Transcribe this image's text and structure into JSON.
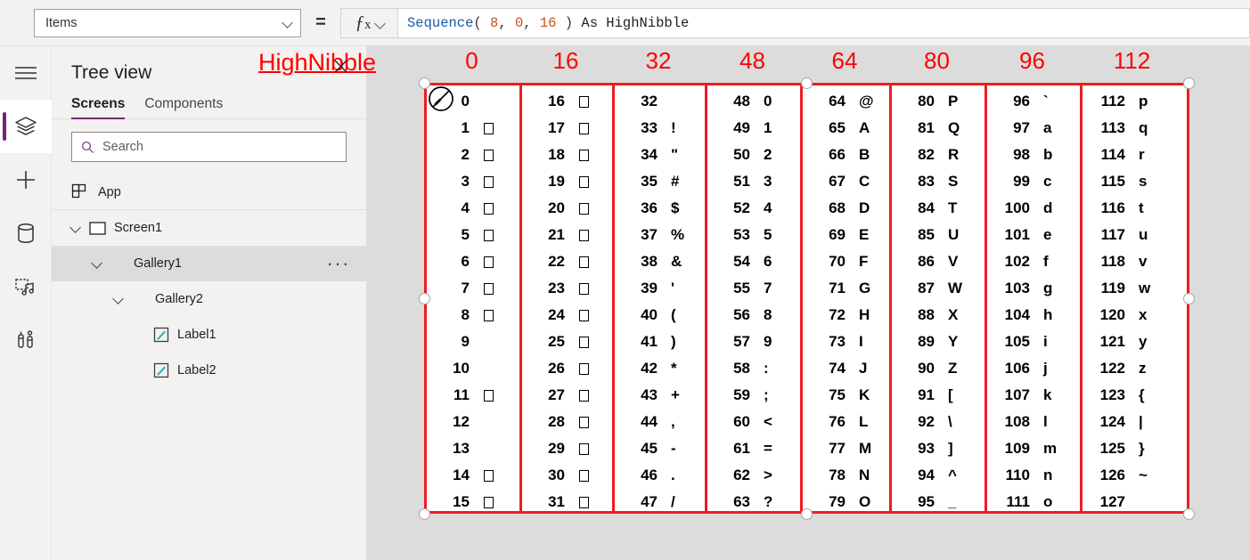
{
  "topbar": {
    "property_value": "Items",
    "equals": "=",
    "fx_label": "fx",
    "formula_parts": [
      {
        "text": "Sequence",
        "kind": "fn"
      },
      {
        "text": "( ",
        "kind": "pun"
      },
      {
        "text": "8",
        "kind": "num"
      },
      {
        "text": ", ",
        "kind": "pun"
      },
      {
        "text": "0",
        "kind": "num"
      },
      {
        "text": ", ",
        "kind": "pun"
      },
      {
        "text": "16",
        "kind": "num"
      },
      {
        "text": " ) ",
        "kind": "pun"
      },
      {
        "text": "As HighNibble",
        "kind": "id"
      }
    ],
    "formula_text": "Sequence( 8, 0, 16 ) As HighNibble"
  },
  "rail": {
    "items": [
      {
        "icon": "hamburger-menu-icon",
        "active": false
      },
      {
        "icon": "layers-tree-view-icon",
        "active": true
      },
      {
        "icon": "plus-insert-icon",
        "active": false
      },
      {
        "icon": "database-data-icon",
        "active": false
      },
      {
        "icon": "media-icon",
        "active": false
      },
      {
        "icon": "tools-settings-icon",
        "active": false
      }
    ]
  },
  "tree": {
    "title": "Tree view",
    "tabs": [
      {
        "label": "Screens",
        "selected": true
      },
      {
        "label": "Components",
        "selected": false
      }
    ],
    "search": {
      "placeholder": "Search",
      "value": "",
      "icon": "search-icon"
    },
    "app_row": {
      "label": "App",
      "icon": "app-icon"
    },
    "nodes": [
      {
        "label": "Screen1",
        "indent": 0,
        "icon": "screen-icon",
        "caret": true,
        "selected": false,
        "menu": false
      },
      {
        "label": "Gallery1",
        "indent": 1,
        "icon": "gallery-icon",
        "caret": true,
        "selected": true,
        "menu": true
      },
      {
        "label": "Gallery2",
        "indent": 2,
        "icon": "gallery-icon",
        "caret": true,
        "selected": false,
        "menu": false
      },
      {
        "label": "Label1",
        "indent": 3,
        "icon": "label-icon",
        "caret": false,
        "selected": false,
        "menu": false
      },
      {
        "label": "Label2",
        "indent": 3,
        "icon": "label-icon",
        "caret": false,
        "selected": false,
        "menu": false
      }
    ]
  },
  "canvas": {
    "annotation_label": "HighNibble",
    "annotation_color": "#ff0000",
    "grid_border_color": "#ee1c24",
    "column_headers": [
      "0",
      "16",
      "32",
      "48",
      "64",
      "80",
      "96",
      "112"
    ],
    "cursor_icon": "no-drop-cursor-icon",
    "x_cursor_icon": "x-cursor-icon",
    "columns": [
      {
        "header": "0",
        "rows": [
          {
            "num": "0",
            "glyph": "",
            "box": false
          },
          {
            "num": "1",
            "glyph": "",
            "box": true
          },
          {
            "num": "2",
            "glyph": "",
            "box": true
          },
          {
            "num": "3",
            "glyph": "",
            "box": true
          },
          {
            "num": "4",
            "glyph": "",
            "box": true
          },
          {
            "num": "5",
            "glyph": "",
            "box": true
          },
          {
            "num": "6",
            "glyph": "",
            "box": true
          },
          {
            "num": "7",
            "glyph": "",
            "box": true
          },
          {
            "num": "8",
            "glyph": "",
            "box": true
          },
          {
            "num": "9",
            "glyph": "",
            "box": false
          },
          {
            "num": "10",
            "glyph": "",
            "box": false
          },
          {
            "num": "11",
            "glyph": "",
            "box": true
          },
          {
            "num": "12",
            "glyph": "",
            "box": false
          },
          {
            "num": "13",
            "glyph": "",
            "box": false
          },
          {
            "num": "14",
            "glyph": "",
            "box": true
          },
          {
            "num": "15",
            "glyph": "",
            "box": true
          }
        ]
      },
      {
        "header": "16",
        "rows": [
          {
            "num": "16",
            "glyph": "",
            "box": true
          },
          {
            "num": "17",
            "glyph": "",
            "box": true
          },
          {
            "num": "18",
            "glyph": "",
            "box": true
          },
          {
            "num": "19",
            "glyph": "",
            "box": true
          },
          {
            "num": "20",
            "glyph": "",
            "box": true
          },
          {
            "num": "21",
            "glyph": "",
            "box": true
          },
          {
            "num": "22",
            "glyph": "",
            "box": true
          },
          {
            "num": "23",
            "glyph": "",
            "box": true
          },
          {
            "num": "24",
            "glyph": "",
            "box": true
          },
          {
            "num": "25",
            "glyph": "",
            "box": true
          },
          {
            "num": "26",
            "glyph": "",
            "box": true
          },
          {
            "num": "27",
            "glyph": "",
            "box": true
          },
          {
            "num": "28",
            "glyph": "",
            "box": true
          },
          {
            "num": "29",
            "glyph": "",
            "box": true
          },
          {
            "num": "30",
            "glyph": "",
            "box": true
          },
          {
            "num": "31",
            "glyph": "",
            "box": true
          }
        ]
      },
      {
        "header": "32",
        "rows": [
          {
            "num": "32",
            "glyph": "",
            "box": false
          },
          {
            "num": "33",
            "glyph": "!",
            "box": false
          },
          {
            "num": "34",
            "glyph": "\"",
            "box": false
          },
          {
            "num": "35",
            "glyph": "#",
            "box": false
          },
          {
            "num": "36",
            "glyph": "$",
            "box": false
          },
          {
            "num": "37",
            "glyph": "%",
            "box": false
          },
          {
            "num": "38",
            "glyph": "&",
            "box": false
          },
          {
            "num": "39",
            "glyph": "'",
            "box": false
          },
          {
            "num": "40",
            "glyph": "(",
            "box": false
          },
          {
            "num": "41",
            "glyph": ")",
            "box": false
          },
          {
            "num": "42",
            "glyph": "*",
            "box": false
          },
          {
            "num": "43",
            "glyph": "+",
            "box": false
          },
          {
            "num": "44",
            "glyph": ",",
            "box": false
          },
          {
            "num": "45",
            "glyph": "-",
            "box": false
          },
          {
            "num": "46",
            "glyph": ".",
            "box": false
          },
          {
            "num": "47",
            "glyph": "/",
            "box": false
          }
        ]
      },
      {
        "header": "48",
        "rows": [
          {
            "num": "48",
            "glyph": "0",
            "box": false
          },
          {
            "num": "49",
            "glyph": "1",
            "box": false
          },
          {
            "num": "50",
            "glyph": "2",
            "box": false
          },
          {
            "num": "51",
            "glyph": "3",
            "box": false
          },
          {
            "num": "52",
            "glyph": "4",
            "box": false
          },
          {
            "num": "53",
            "glyph": "5",
            "box": false
          },
          {
            "num": "54",
            "glyph": "6",
            "box": false
          },
          {
            "num": "55",
            "glyph": "7",
            "box": false
          },
          {
            "num": "56",
            "glyph": "8",
            "box": false
          },
          {
            "num": "57",
            "glyph": "9",
            "box": false
          },
          {
            "num": "58",
            "glyph": ":",
            "box": false
          },
          {
            "num": "59",
            "glyph": ";",
            "box": false
          },
          {
            "num": "60",
            "glyph": "<",
            "box": false
          },
          {
            "num": "61",
            "glyph": "=",
            "box": false
          },
          {
            "num": "62",
            "glyph": ">",
            "box": false
          },
          {
            "num": "63",
            "glyph": "?",
            "box": false
          }
        ]
      },
      {
        "header": "64",
        "rows": [
          {
            "num": "64",
            "glyph": "@",
            "box": false
          },
          {
            "num": "65",
            "glyph": "A",
            "box": false
          },
          {
            "num": "66",
            "glyph": "B",
            "box": false
          },
          {
            "num": "67",
            "glyph": "C",
            "box": false
          },
          {
            "num": "68",
            "glyph": "D",
            "box": false
          },
          {
            "num": "69",
            "glyph": "E",
            "box": false
          },
          {
            "num": "70",
            "glyph": "F",
            "box": false
          },
          {
            "num": "71",
            "glyph": "G",
            "box": false
          },
          {
            "num": "72",
            "glyph": "H",
            "box": false
          },
          {
            "num": "73",
            "glyph": "I",
            "box": false
          },
          {
            "num": "74",
            "glyph": "J",
            "box": false
          },
          {
            "num": "75",
            "glyph": "K",
            "box": false
          },
          {
            "num": "76",
            "glyph": "L",
            "box": false
          },
          {
            "num": "77",
            "glyph": "M",
            "box": false
          },
          {
            "num": "78",
            "glyph": "N",
            "box": false
          },
          {
            "num": "79",
            "glyph": "O",
            "box": false
          }
        ]
      },
      {
        "header": "80",
        "rows": [
          {
            "num": "80",
            "glyph": "P",
            "box": false
          },
          {
            "num": "81",
            "glyph": "Q",
            "box": false
          },
          {
            "num": "82",
            "glyph": "R",
            "box": false
          },
          {
            "num": "83",
            "glyph": "S",
            "box": false
          },
          {
            "num": "84",
            "glyph": "T",
            "box": false
          },
          {
            "num": "85",
            "glyph": "U",
            "box": false
          },
          {
            "num": "86",
            "glyph": "V",
            "box": false
          },
          {
            "num": "87",
            "glyph": "W",
            "box": false
          },
          {
            "num": "88",
            "glyph": "X",
            "box": false
          },
          {
            "num": "89",
            "glyph": "Y",
            "box": false
          },
          {
            "num": "90",
            "glyph": "Z",
            "box": false
          },
          {
            "num": "91",
            "glyph": "[",
            "box": false
          },
          {
            "num": "92",
            "glyph": "\\",
            "box": false
          },
          {
            "num": "93",
            "glyph": "]",
            "box": false
          },
          {
            "num": "94",
            "glyph": "^",
            "box": false
          },
          {
            "num": "95",
            "glyph": "_",
            "box": false
          }
        ]
      },
      {
        "header": "96",
        "rows": [
          {
            "num": "96",
            "glyph": "`",
            "box": false
          },
          {
            "num": "97",
            "glyph": "a",
            "box": false
          },
          {
            "num": "98",
            "glyph": "b",
            "box": false
          },
          {
            "num": "99",
            "glyph": "c",
            "box": false
          },
          {
            "num": "100",
            "glyph": "d",
            "box": false
          },
          {
            "num": "101",
            "glyph": "e",
            "box": false
          },
          {
            "num": "102",
            "glyph": "f",
            "box": false
          },
          {
            "num": "103",
            "glyph": "g",
            "box": false
          },
          {
            "num": "104",
            "glyph": "h",
            "box": false
          },
          {
            "num": "105",
            "glyph": "i",
            "box": false
          },
          {
            "num": "106",
            "glyph": "j",
            "box": false
          },
          {
            "num": "107",
            "glyph": "k",
            "box": false
          },
          {
            "num": "108",
            "glyph": "l",
            "box": false
          },
          {
            "num": "109",
            "glyph": "m",
            "box": false
          },
          {
            "num": "110",
            "glyph": "n",
            "box": false
          },
          {
            "num": "111",
            "glyph": "o",
            "box": false
          }
        ]
      },
      {
        "header": "112",
        "rows": [
          {
            "num": "112",
            "glyph": "p",
            "box": false
          },
          {
            "num": "113",
            "glyph": "q",
            "box": false
          },
          {
            "num": "114",
            "glyph": "r",
            "box": false
          },
          {
            "num": "115",
            "glyph": "s",
            "box": false
          },
          {
            "num": "116",
            "glyph": "t",
            "box": false
          },
          {
            "num": "117",
            "glyph": "u",
            "box": false
          },
          {
            "num": "118",
            "glyph": "v",
            "box": false
          },
          {
            "num": "119",
            "glyph": "w",
            "box": false
          },
          {
            "num": "120",
            "glyph": "x",
            "box": false
          },
          {
            "num": "121",
            "glyph": "y",
            "box": false
          },
          {
            "num": "122",
            "glyph": "z",
            "box": false
          },
          {
            "num": "123",
            "glyph": "{",
            "box": false
          },
          {
            "num": "124",
            "glyph": "|",
            "box": false
          },
          {
            "num": "125",
            "glyph": "}",
            "box": false
          },
          {
            "num": "126",
            "glyph": "~",
            "box": false
          },
          {
            "num": "127",
            "glyph": "",
            "box": false
          }
        ]
      }
    ]
  }
}
